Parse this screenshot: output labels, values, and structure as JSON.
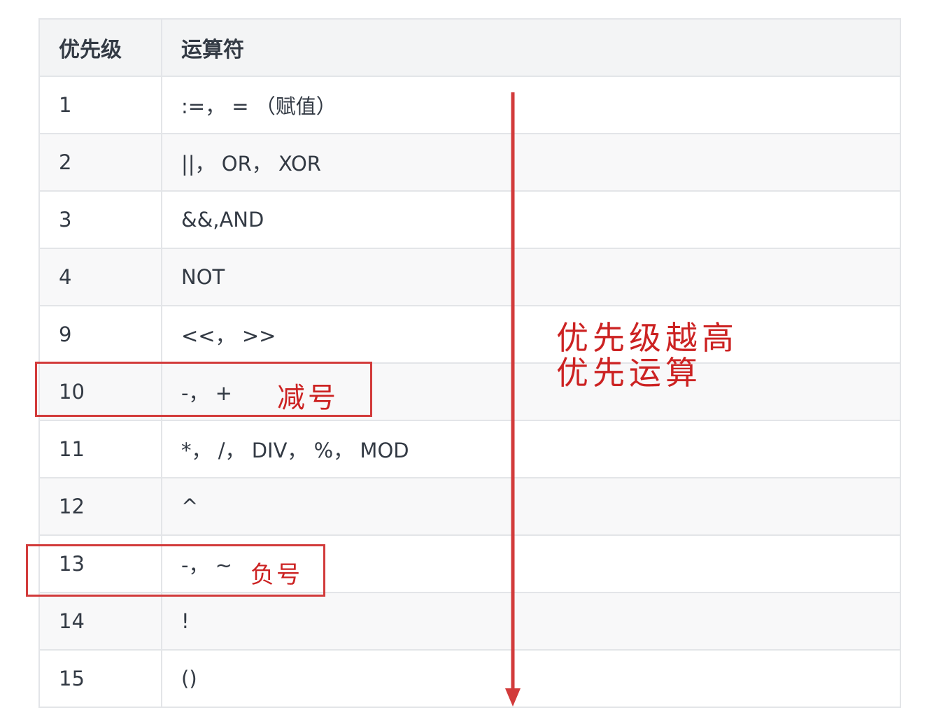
{
  "table": {
    "headers": {
      "priority": "优先级",
      "operator": "运算符"
    },
    "rows": [
      {
        "priority": "1",
        "operator": ":=， = （赋值）"
      },
      {
        "priority": "2",
        "operator": "||， OR， XOR"
      },
      {
        "priority": "3",
        "operator": "&&,AND"
      },
      {
        "priority": "4",
        "operator": "NOT"
      },
      {
        "priority": "9",
        "operator": "<<， >>"
      },
      {
        "priority": "10",
        "operator": "-， +"
      },
      {
        "priority": "11",
        "operator": "*， /， DIV， %， MOD"
      },
      {
        "priority": "12",
        "operator": "^"
      },
      {
        "priority": "13",
        "operator": "-， ~"
      },
      {
        "priority": "14",
        "operator": "!"
      },
      {
        "priority": "15",
        "operator": "()"
      }
    ]
  },
  "annotations": {
    "subtract_note": "减号",
    "negative_note": "负号",
    "priority_note_line1": "优先级越高",
    "priority_note_line2": "优先运算",
    "color": "#d23b3b"
  }
}
